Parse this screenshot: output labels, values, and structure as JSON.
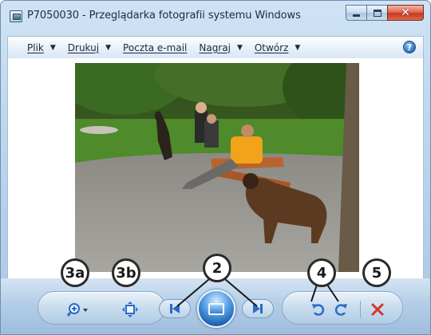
{
  "window": {
    "title": "P7050030 - Przeglądarka fotografii systemu Windows",
    "icon": "photo-viewer-app-icon",
    "controls": {
      "minimize_icon": "minimize-icon",
      "maximize_icon": "maximize-icon",
      "close_icon": "close-icon"
    }
  },
  "menu": {
    "items": [
      {
        "label": "Plik",
        "has_dropdown": true
      },
      {
        "label": "Drukuj",
        "has_dropdown": true
      },
      {
        "label": "Poczta e-mail",
        "has_dropdown": false
      },
      {
        "label": "Nagraj",
        "has_dropdown": true
      },
      {
        "label": "Otwórz",
        "has_dropdown": true
      }
    ],
    "help_label": "?"
  },
  "photo": {
    "subject": "photo-people-on-bench-with-dogs"
  },
  "controls": {
    "zoom_icon": "zoom-icon",
    "fit_icon": "actual-size-icon",
    "prev_icon": "previous-icon",
    "slideshow_icon": "slideshow-icon",
    "next_icon": "next-icon",
    "rotate_left_icon": "rotate-counterclockwise-icon",
    "rotate_right_icon": "rotate-clockwise-icon",
    "delete_icon": "delete-icon"
  },
  "callouts": {
    "zoom": "3a",
    "fit": "3b",
    "navigation": "2",
    "rotate": "4",
    "delete": "5"
  },
  "colors": {
    "delete_red": "#d8342a",
    "accent_blue": "#2a6cc4"
  }
}
